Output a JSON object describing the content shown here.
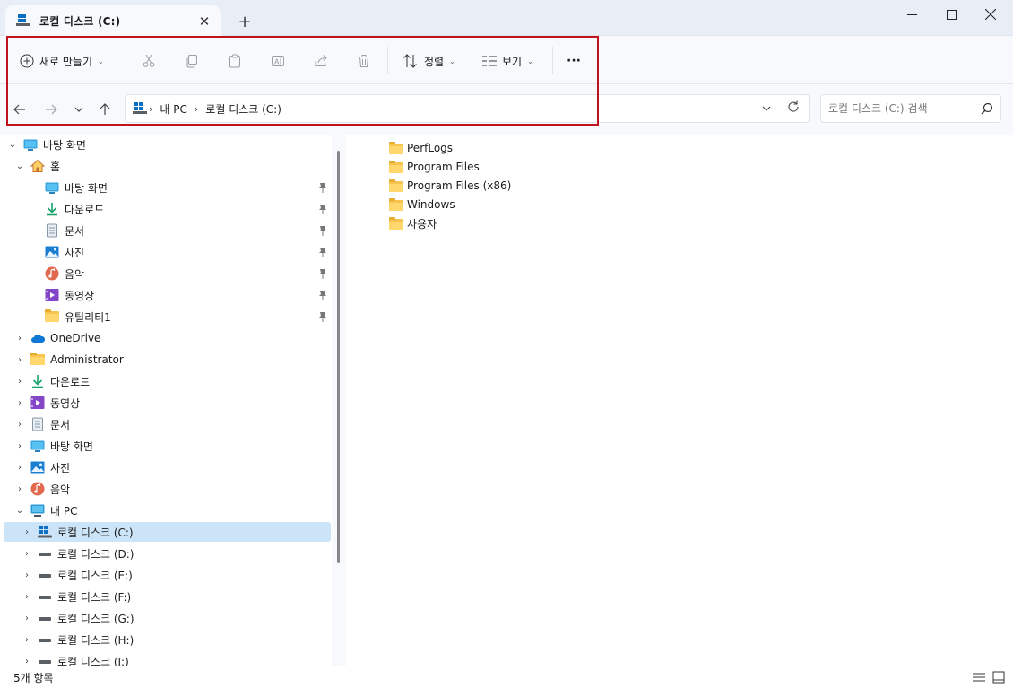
{
  "window": {
    "tab_title": "로컬 디스크 (C:)",
    "tab_close": "✕",
    "new_tab": "+",
    "min": "—",
    "max": "☐",
    "close": "✕"
  },
  "toolbar": {
    "new_label": "새로 만들기",
    "sort_label": "정렬",
    "view_label": "보기",
    "more_label": "···"
  },
  "address": {
    "crumbs": [
      "내 PC",
      "로컬 디스크 (C:)"
    ],
    "search_placeholder": "로컬 디스크 (C:) 검색"
  },
  "tree": {
    "items": [
      {
        "label": "바탕 화면",
        "icon": "desktop-icon",
        "expander": "⌄"
      },
      {
        "label": "홈",
        "icon": "home-icon",
        "expander": "⌄"
      },
      {
        "label": "바탕 화면",
        "icon": "desktop-icon",
        "pinned": true
      },
      {
        "label": "다운로드",
        "icon": "download-icon",
        "pinned": true
      },
      {
        "label": "문서",
        "icon": "document-icon",
        "pinned": true
      },
      {
        "label": "사진",
        "icon": "pictures-icon",
        "pinned": true
      },
      {
        "label": "음악",
        "icon": "music-icon",
        "pinned": true
      },
      {
        "label": "동영상",
        "icon": "video-icon",
        "pinned": true
      },
      {
        "label": "유틸리티1",
        "icon": "folder-icon",
        "pinned": true
      },
      {
        "label": "OneDrive",
        "icon": "onedrive-icon",
        "expander": "›"
      },
      {
        "label": "Administrator",
        "icon": "folder-icon",
        "expander": "›"
      },
      {
        "label": "다운로드",
        "icon": "download-icon",
        "expander": "›"
      },
      {
        "label": "동영상",
        "icon": "video-icon",
        "expander": "›"
      },
      {
        "label": "문서",
        "icon": "document-icon",
        "expander": "›"
      },
      {
        "label": "바탕 화면",
        "icon": "desktop-icon",
        "expander": "›"
      },
      {
        "label": "사진",
        "icon": "pictures-icon",
        "expander": "›"
      },
      {
        "label": "음악",
        "icon": "music-icon",
        "expander": "›"
      },
      {
        "label": "내 PC",
        "icon": "pc-icon",
        "expander": "⌄"
      },
      {
        "label": "로컬 디스크 (C:)",
        "icon": "system-drive-icon",
        "expander": "›",
        "selected": true
      },
      {
        "label": "로컬 디스크 (D:)",
        "icon": "drive-icon",
        "expander": "›"
      },
      {
        "label": "로컬 디스크 (E:)",
        "icon": "drive-icon",
        "expander": "›"
      },
      {
        "label": "로컬 디스크 (F:)",
        "icon": "drive-icon",
        "expander": "›"
      },
      {
        "label": "로컬 디스크 (G:)",
        "icon": "drive-icon",
        "expander": "›"
      },
      {
        "label": "로컬 디스크 (H:)",
        "icon": "drive-icon",
        "expander": "›"
      },
      {
        "label": "로컬 디스크 (I:)",
        "icon": "drive-icon",
        "expander": "›"
      }
    ]
  },
  "files": [
    "PerfLogs",
    "Program Files",
    "Program Files (x86)",
    "Windows",
    "사용자"
  ],
  "status": {
    "item_count": "5개 항목"
  },
  "colors": {
    "highlight": "#c0131b",
    "selected": "#cce4f7",
    "folder": "#f6c44f",
    "accent": "#0a6fc2"
  }
}
